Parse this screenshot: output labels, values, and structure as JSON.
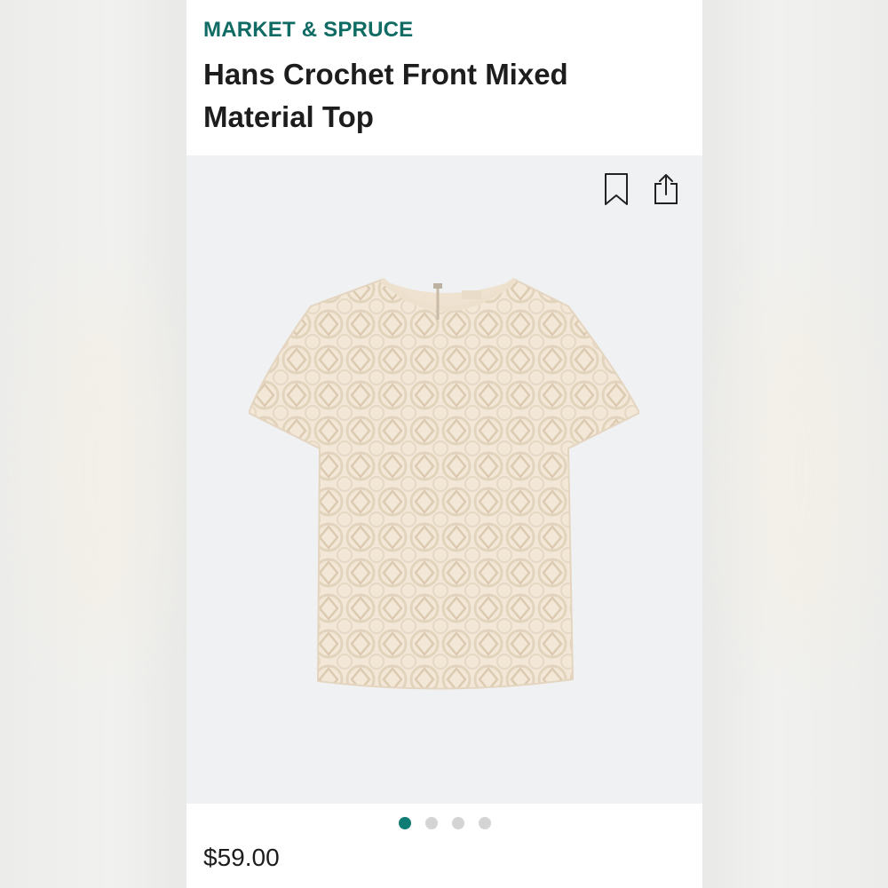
{
  "product": {
    "brand": "MARKET & SPRUCE",
    "title": "Hans Crochet Front Mixed Material Top",
    "price": "$59.00"
  },
  "actions": {
    "bookmark_icon": "bookmark-icon",
    "share_icon": "share-icon"
  },
  "carousel": {
    "total": 4,
    "active_index": 0
  },
  "colors": {
    "brand": "#0f6b63",
    "active_dot": "#0f7d73",
    "inactive_dot": "#d4d4d4",
    "garment": "#f3e9da"
  }
}
